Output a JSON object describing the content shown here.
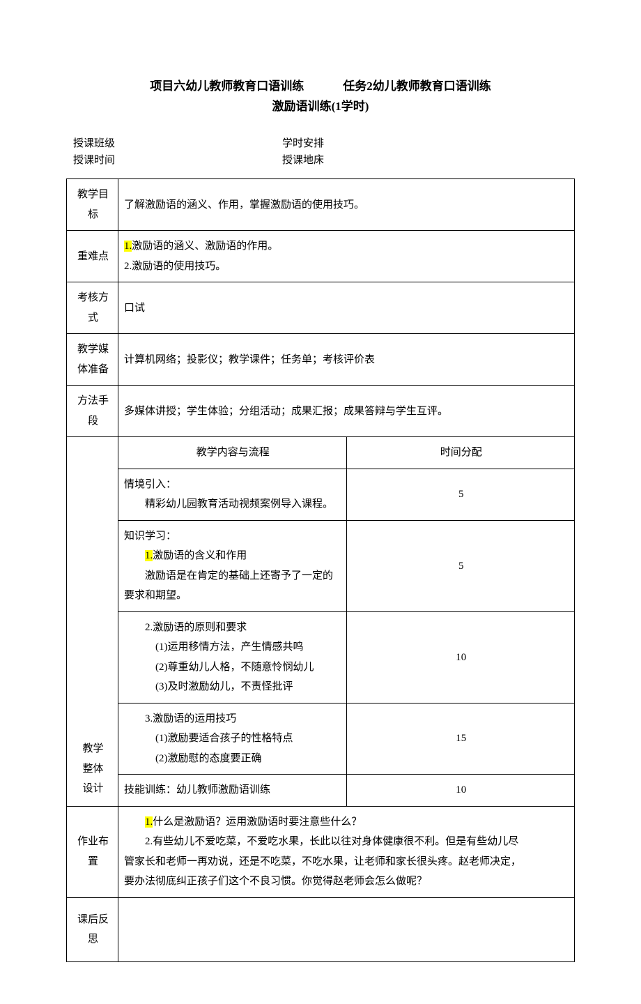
{
  "title": {
    "left": "项目六幼儿教师教育口语训练",
    "right": "任务2幼儿教师教育口语训练",
    "sub": "激励语训练(1学时)"
  },
  "meta": {
    "class_label": "授课班级",
    "hours_label": "学时安排",
    "time_label": "授课时间",
    "place_label": "授课地床"
  },
  "rows": {
    "goal_label": "教学目标",
    "goal_value": "了解激励语的涵义、作用，掌握激励语的使用技巧。",
    "diff_label": "重难点",
    "diff_line1_hl": "1.",
    "diff_line1_rest": "激励语的涵义、激励语的作用。",
    "diff_line2": "2.激励语的使用技巧。",
    "assess_label": "考核方式",
    "assess_value": "口试",
    "media_label_l1": "教学媒",
    "media_label_l2": "体准备",
    "media_value": "计算机网络；投影仪；教学课件；任务单；考核评价表",
    "method_label_l1": "方法手",
    "method_label_l2": "段",
    "method_value": "多媒体讲授；学生体验；分组活动；成果汇报；成果答辩与学生互评。",
    "design_label_l1": "教学",
    "design_label_l2": "整体",
    "design_label_l3": "设计",
    "content_header": "教学内容与流程",
    "time_header": "时间分配",
    "sec1_l1": "情境引入：",
    "sec1_l2": "精彩幼儿园教育活动视频案例导入课程。",
    "sec1_time": "5",
    "sec2_l1": "知识学习：",
    "sec2_l2_hl": "1.",
    "sec2_l2_rest": "激励语的含义和作用",
    "sec2_l3": "激励语是在肯定的基础上还寄予了一定的要求和期望。",
    "sec2_time": "5",
    "sec3_l1": "2.激励语的原则和要求",
    "sec3_l2": "(1)运用移情方法，产生情感共鸣",
    "sec3_l3": "(2)尊重幼儿人格，不随意怜悯幼儿",
    "sec3_l4": "(3)及时激励幼儿，不责怪批评",
    "sec3_time": "10",
    "sec4_l1": "3.激励语的运用技巧",
    "sec4_l2": "(1)激励要适合孩子的性格特点",
    "sec4_l3": "(2)激励慰的态度要正确",
    "sec4_time": "15",
    "sec5_l1": "技能训练：幼儿教师激励语训练",
    "sec5_time": "10",
    "hw_label": "作业布置",
    "hw_l1_hl": "1.",
    "hw_l1_rest": "什么是激励语？运用激励语时要注意些什么？",
    "hw_l2": "2.有些幼儿不爱吃菜，不爱吃水果，长此以往对身体健康很不利。但是有些幼儿尽",
    "hw_l3": "管家长和老师一再劝说，还是不吃菜，不吃水果，让老师和家长很头疼。赵老师决定，",
    "hw_l4": "要办法彻底纠正孩子们这个不良习惯。你觉得赵老师会怎么做呢？",
    "reflect_label": "课后反思"
  }
}
